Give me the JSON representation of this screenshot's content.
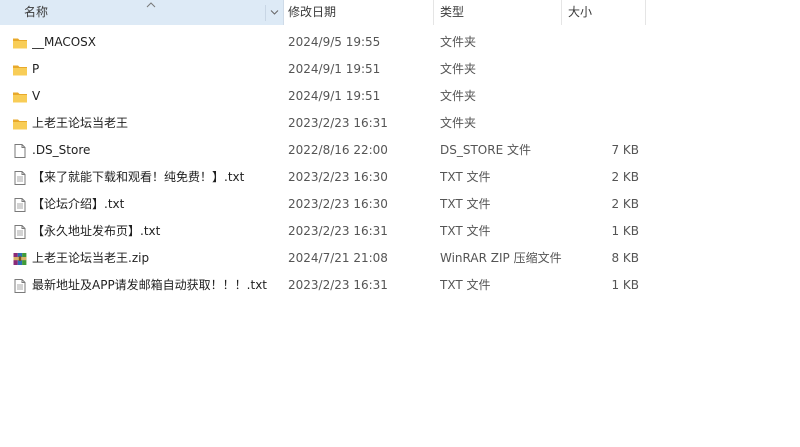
{
  "header": {
    "name": "名称",
    "date": "修改日期",
    "type": "类型",
    "size": "大小"
  },
  "rows": [
    {
      "name": "__MACOSX",
      "date": "2024/9/5 19:55",
      "type": "文件夹",
      "size": "",
      "icon": "folder"
    },
    {
      "name": "P",
      "date": "2024/9/1 19:51",
      "type": "文件夹",
      "size": "",
      "icon": "folder"
    },
    {
      "name": "V",
      "date": "2024/9/1 19:51",
      "type": "文件夹",
      "size": "",
      "icon": "folder"
    },
    {
      "name": "上老王论坛当老王",
      "date": "2023/2/23 16:31",
      "type": "文件夹",
      "size": "",
      "icon": "folder"
    },
    {
      "name": ".DS_Store",
      "date": "2022/8/16 22:00",
      "type": "DS_STORE 文件",
      "size": "7 KB",
      "icon": "file"
    },
    {
      "name": "【来了就能下载和观看！纯免费！】.txt",
      "date": "2023/2/23 16:30",
      "type": "TXT 文件",
      "size": "2 KB",
      "icon": "text-file"
    },
    {
      "name": "【论坛介绍】.txt",
      "date": "2023/2/23 16:30",
      "type": "TXT 文件",
      "size": "2 KB",
      "icon": "text-file"
    },
    {
      "name": "【永久地址发布页】.txt",
      "date": "2023/2/23 16:31",
      "type": "TXT 文件",
      "size": "1 KB",
      "icon": "text-file"
    },
    {
      "name": "上老王论坛当老王.zip",
      "date": "2024/7/21 21:08",
      "type": "WinRAR ZIP 压缩文件",
      "size": "8 KB",
      "icon": "winrar-archive"
    },
    {
      "name": "最新地址及APP请发邮箱自动获取！！！.txt",
      "date": "2023/2/23 16:31",
      "type": "TXT 文件",
      "size": "1 KB",
      "icon": "text-file"
    }
  ]
}
